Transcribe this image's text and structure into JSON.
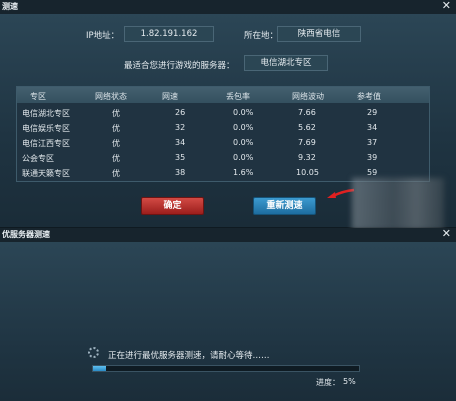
{
  "top_dialog": {
    "title": "测速",
    "close_glyph": "✕",
    "ip_label": "IP地址：",
    "ip_value": "1.82.191.162",
    "location_label": "所在地：",
    "location_value": "陕西省电信",
    "best_server_label": "最适合您进行游戏的服务器：",
    "best_server_value": "电信湖北专区",
    "table": {
      "headers": [
        "专区",
        "网络状态",
        "网速",
        "丢包率",
        "网络波动",
        "参考值"
      ],
      "rows": [
        [
          "电信湖北专区",
          "优",
          "26",
          "0.0%",
          "7.66",
          "29"
        ],
        [
          "电信娱乐专区",
          "优",
          "32",
          "0.0%",
          "5.62",
          "34"
        ],
        [
          "电信江西专区",
          "优",
          "34",
          "0.0%",
          "7.69",
          "37"
        ],
        [
          "公会专区",
          "优",
          "35",
          "0.0%",
          "9.32",
          "39"
        ],
        [
          "联通天籁专区",
          "优",
          "38",
          "1.6%",
          "10.05",
          "59"
        ]
      ]
    },
    "confirm_button": "确定",
    "retest_button": "重新测速"
  },
  "bottom_dialog": {
    "title": "优服务器测速",
    "close_glyph": "✕",
    "status_text": "正在进行最优服务器测速，请耐心等待……",
    "progress_label": "进度：",
    "progress_value": "5%",
    "progress_fraction": 0.05
  },
  "colors": {
    "accent_red": "#c23a35",
    "accent_blue": "#2e87bd",
    "pointer_arrow": "#e02020"
  }
}
